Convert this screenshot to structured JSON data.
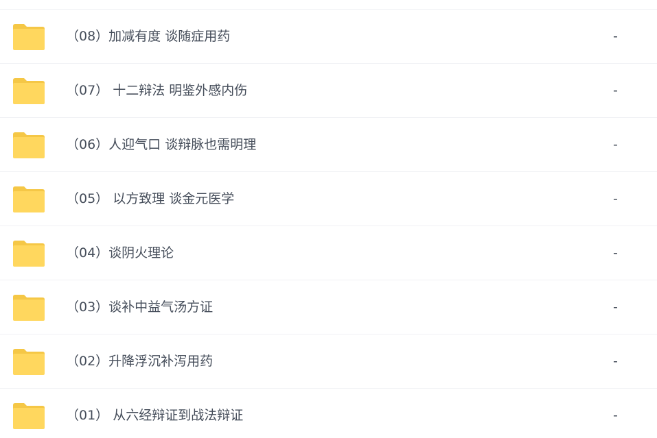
{
  "file_list": {
    "rows": [
      {
        "name": "（08）加减有度 谈随症用药",
        "size": "-",
        "icon": "folder-icon"
      },
      {
        "name": "（07） 十二辩法 明鉴外感内伤",
        "size": "-",
        "icon": "folder-icon"
      },
      {
        "name": "（06）人迎气口 谈辩脉也需明理",
        "size": "-",
        "icon": "folder-icon"
      },
      {
        "name": "（05） 以方致理 谈金元医学",
        "size": "-",
        "icon": "folder-icon"
      },
      {
        "name": "（04）谈阴火理论",
        "size": "-",
        "icon": "folder-icon"
      },
      {
        "name": "（03）谈补中益气汤方证",
        "size": "-",
        "icon": "folder-icon"
      },
      {
        "name": "（02）升降浮沉补泻用药",
        "size": "-",
        "icon": "folder-icon"
      },
      {
        "name": "（01） 从六经辩证到战法辩证",
        "size": "-",
        "icon": "folder-icon"
      }
    ]
  },
  "colors": {
    "folder_fill": "#ffd75e",
    "folder_tab": "#f5c746",
    "text": "#454d5a",
    "divider": "#f0f1f4"
  }
}
